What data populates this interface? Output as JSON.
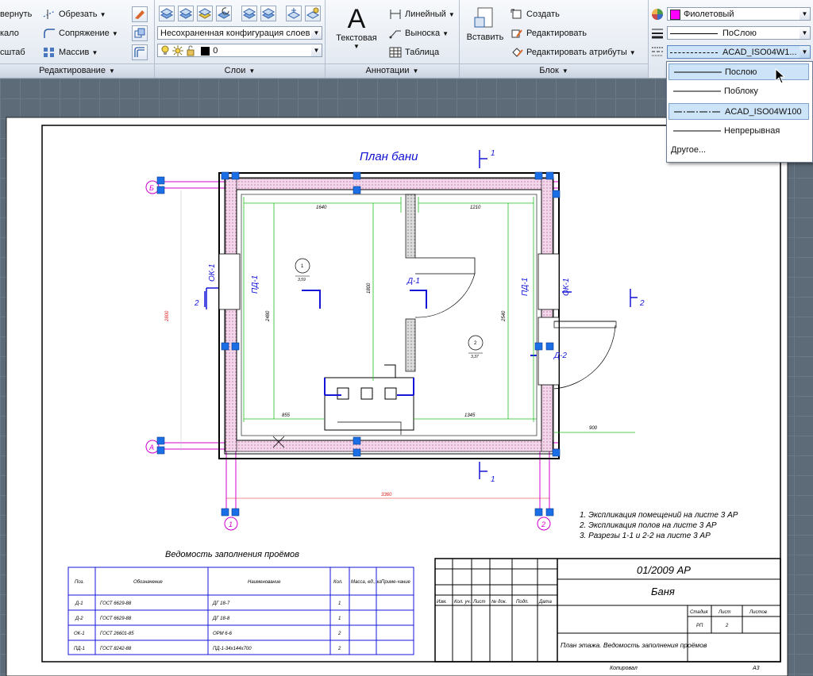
{
  "ribbon": {
    "modify": {
      "title": "Редактирование",
      "rotate": "вернуть",
      "trim": "Обрезать",
      "mirror": "кало",
      "fillet": "Сопряжение",
      "scale": "сштаб",
      "array": "Массив"
    },
    "layers": {
      "title": "Слои",
      "layer_state": "Несохраненная конфигурация слоев",
      "current_layer": "0",
      "layer_color": "#000000"
    },
    "annotation": {
      "title": "Аннотации",
      "text": "Текстовая",
      "linear": "Линейный",
      "leader": "Выноска",
      "table": "Таблица"
    },
    "block": {
      "title": "Блок",
      "insert": "Вставить",
      "create": "Создать",
      "edit": "Редактировать",
      "edit_attributes": "Редактировать атрибуты"
    },
    "properties": {
      "color_name": "Фиолетовый",
      "color_value": "#ff00ff",
      "lineweight": "ПоСлою",
      "linetype": "ACAD_ISO04W1..."
    }
  },
  "linetype_dropdown": {
    "options": [
      "Послою",
      "Поблоку",
      "ACAD_ISO04W100",
      "Непрерывная"
    ],
    "other": "Другое..."
  },
  "drawing": {
    "title": "План бани",
    "notes": [
      "1. Экспликация помещений на листе 3 АР",
      "2. Экспликация полов на листе 3 АР",
      "3. Разрезы 1-1 и 2-2 на листе 3 АР"
    ],
    "axes": [
      "Б",
      "А",
      "1",
      "2"
    ],
    "section_marks": [
      "1",
      "1",
      "2",
      "2"
    ],
    "window_labels": [
      "ОК-1",
      "ОК-1",
      "ПД-1",
      "ПД-1"
    ],
    "door_labels": [
      "Д-1",
      "Д-2"
    ],
    "room_tags": [
      {
        "num": "1",
        "area": "3,59"
      },
      {
        "num": "2",
        "area": "3,37"
      }
    ],
    "dimensions": [
      "1640",
      "1210",
      "2480",
      "1800",
      "2540",
      "855",
      "1345",
      "3360",
      "2800",
      "900"
    ]
  },
  "schedule": {
    "title": "Ведомость заполнения проёмов",
    "headers": [
      "Поз.",
      "Обозначение",
      "Наименование",
      "Кол.",
      "Масса, ед., кг",
      "Приме-чание"
    ],
    "rows": [
      [
        "Д-1",
        "ГОСТ 6629-88",
        "ДГ 18-7",
        "1",
        "",
        ""
      ],
      [
        "Д-2",
        "ГОСТ 6629-88",
        "ДГ 18-8",
        "1",
        "",
        ""
      ],
      [
        "ОК-1",
        "ГОСТ 26601-85",
        "ОРМ 6-6",
        "2",
        "",
        ""
      ],
      [
        "ПД-1",
        "ГОСТ 8242-88",
        "ПД-1-34х144х700",
        "2",
        "",
        ""
      ]
    ]
  },
  "title_block": {
    "code": "01/2009 АР",
    "project": "Баня",
    "sheet_title": "План этажа. Ведомость заполнения проёмов",
    "col_headers": [
      "Изм.",
      "Кол. уч.",
      "Лист",
      "№ док.",
      "Подп.",
      "Дата"
    ],
    "stage_headers": [
      "Стадия",
      "Лист",
      "Листов"
    ],
    "stage_values": [
      "РП",
      "2",
      ""
    ],
    "copied": "Копировал",
    "format": "А3"
  }
}
